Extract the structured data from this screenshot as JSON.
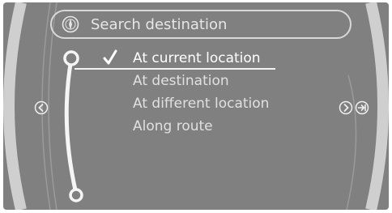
{
  "search": {
    "label": "Search destination",
    "icon": "compass-icon"
  },
  "menu": {
    "items": [
      {
        "label": "At current location",
        "selected": true
      },
      {
        "label": "At destination",
        "selected": false
      },
      {
        "label": "At different location",
        "selected": false
      },
      {
        "label": "Along route",
        "selected": false
      }
    ]
  },
  "icons": {
    "left_nav": "chevron-left-icon",
    "right_nav": "chevron-right-icon",
    "right_extra": "arrow-into-icon",
    "check": "checkmark-icon"
  },
  "colors": {
    "screen_bg": "#808080",
    "bezel": "#d7d7d7",
    "text": "#e0e0e0",
    "highlight": "#ffffff"
  }
}
